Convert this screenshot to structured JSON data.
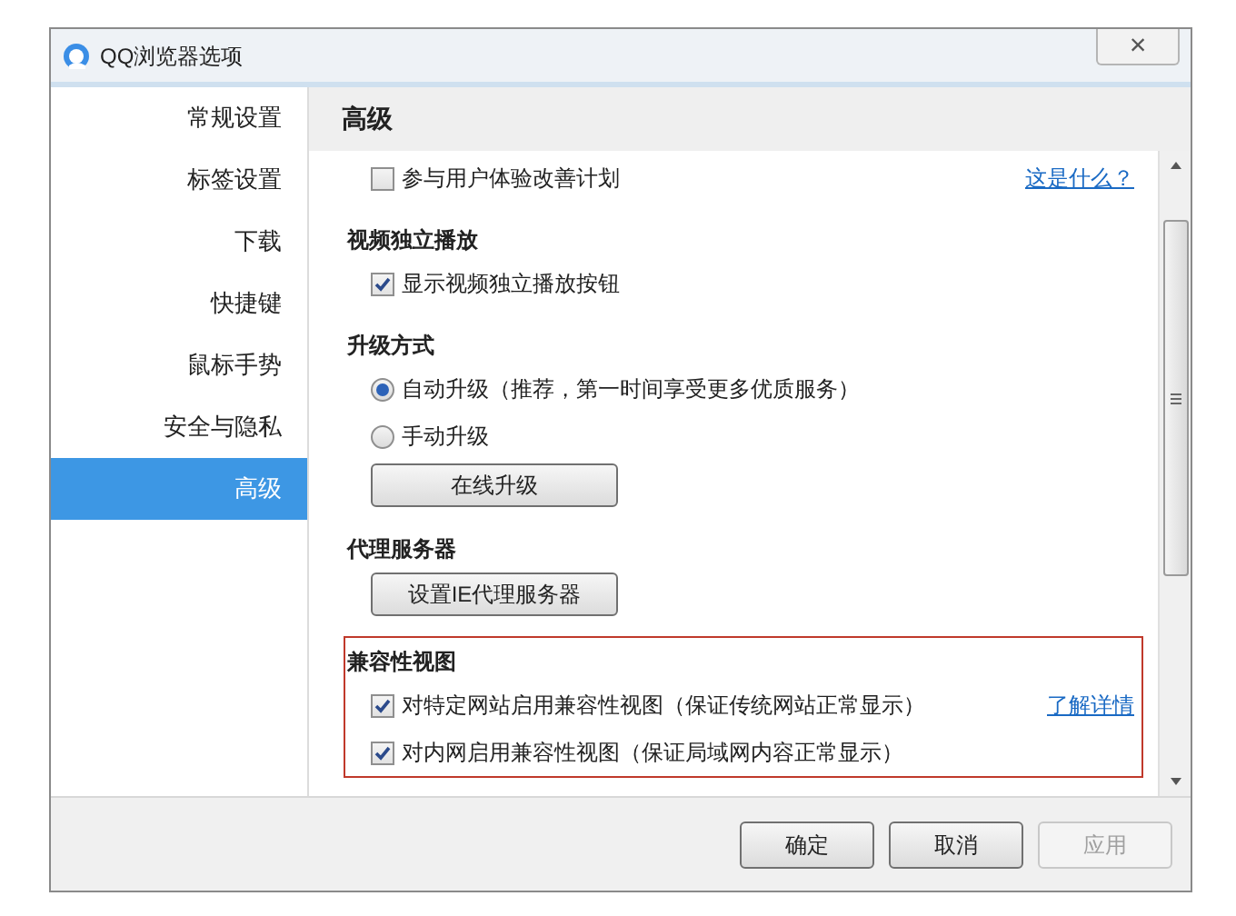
{
  "window": {
    "title": "QQ浏览器选项",
    "close": "×"
  },
  "sidebar": {
    "items": [
      {
        "label": "常规设置",
        "selected": false
      },
      {
        "label": "标签设置",
        "selected": false
      },
      {
        "label": "下载",
        "selected": false
      },
      {
        "label": "快捷键",
        "selected": false
      },
      {
        "label": "鼠标手势",
        "selected": false
      },
      {
        "label": "安全与隐私",
        "selected": false
      },
      {
        "label": "高级",
        "selected": true
      }
    ]
  },
  "panel": {
    "heading": "高级"
  },
  "sections": [
    {
      "highlighted": false,
      "items": [
        {
          "kind": "checkbox",
          "label": "参与用户体验改善计划",
          "checked": false,
          "link": "这是什么？"
        }
      ]
    },
    {
      "heading": "视频独立播放",
      "highlighted": false,
      "items": [
        {
          "kind": "checkbox",
          "label": "显示视频独立播放按钮",
          "checked": true
        }
      ]
    },
    {
      "heading": "升级方式",
      "highlighted": false,
      "items": [
        {
          "kind": "radio",
          "label": "自动升级（推荐，第一时间享受更多优质服务）",
          "selected": true
        },
        {
          "kind": "radio",
          "label": "手动升级",
          "selected": false
        },
        {
          "kind": "button",
          "label": "在线升级"
        }
      ]
    },
    {
      "heading": "代理服务器",
      "highlighted": false,
      "items": [
        {
          "kind": "button",
          "label": "设置IE代理服务器"
        }
      ]
    },
    {
      "heading": "兼容性视图",
      "highlighted": true,
      "items": [
        {
          "kind": "checkbox",
          "label": "对特定网站启用兼容性视图（保证传统网站正常显示）",
          "checked": true,
          "link": "了解详情"
        },
        {
          "kind": "checkbox",
          "label": "对内网启用兼容性视图（保证局域网内容正常显示）",
          "checked": true
        }
      ]
    }
  ],
  "footer": {
    "buttons": [
      {
        "label": "确定",
        "disabled": false
      },
      {
        "label": "取消",
        "disabled": false
      },
      {
        "label": "应用",
        "disabled": true
      }
    ]
  }
}
